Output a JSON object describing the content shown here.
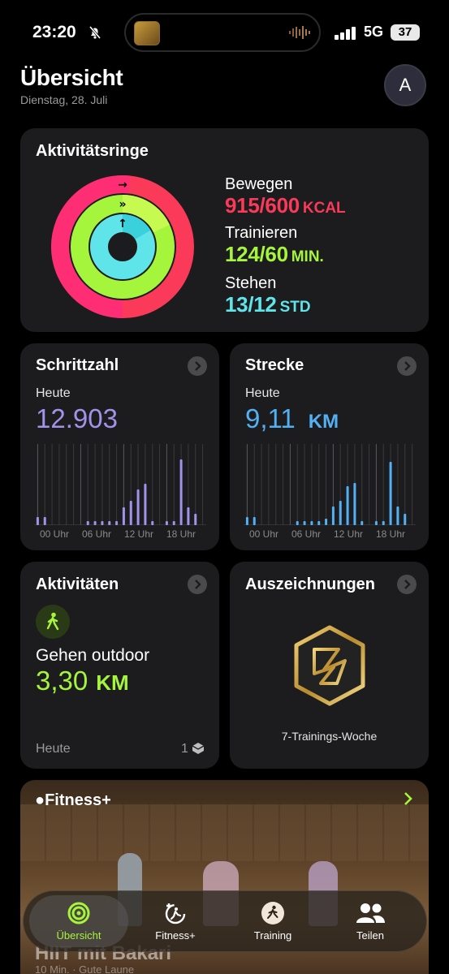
{
  "status_bar": {
    "time": "23:20",
    "network": "5G",
    "battery": "37"
  },
  "header": {
    "title": "Übersicht",
    "date": "Dienstag, 28. Juli",
    "avatar_initial": "A"
  },
  "rings": {
    "title": "Aktivitätsringe",
    "move": {
      "label": "Bewegen",
      "value": "915/600",
      "unit": "KCAL",
      "color": "#fa3a58",
      "progress": 1.525
    },
    "exercise": {
      "label": "Trainieren",
      "value": "124/60",
      "unit": "MIN.",
      "color": "#a6f53d",
      "progress": 2.067
    },
    "stand": {
      "label": "Stehen",
      "value": "13/12",
      "unit": "STD",
      "color": "#5fe4e9",
      "progress": 1.083
    }
  },
  "steps": {
    "title": "Schrittzahl",
    "sublabel": "Heute",
    "value": "12.903",
    "color": "#a392ea",
    "axis_labels": [
      "00 Uhr",
      "06 Uhr",
      "12 Uhr",
      "18 Uhr"
    ],
    "hourly": [
      0.1,
      0.1,
      0,
      0,
      0,
      0,
      0,
      0.05,
      0.05,
      0.05,
      0.05,
      0.05,
      0.22,
      0.3,
      0.44,
      0.51,
      0.05,
      0,
      0.05,
      0.05,
      0.81,
      0.22,
      0.14,
      0
    ]
  },
  "distance": {
    "title": "Strecke",
    "sublabel": "Heute",
    "value": "9,11",
    "unit": "KM",
    "color": "#52b0f5",
    "axis_labels": [
      "00 Uhr",
      "06 Uhr",
      "12 Uhr",
      "18 Uhr"
    ],
    "hourly": [
      0.1,
      0.1,
      0,
      0,
      0,
      0,
      0,
      0.05,
      0.05,
      0.05,
      0.05,
      0.08,
      0.23,
      0.3,
      0.48,
      0.52,
      0.05,
      0,
      0.05,
      0.05,
      0.78,
      0.23,
      0.14,
      0
    ]
  },
  "activities": {
    "title": "Aktivitäten",
    "name": "Gehen outdoor",
    "value": "3,30",
    "unit": "KM",
    "footer_label": "Heute",
    "count": "1",
    "color": "#a6f53d"
  },
  "awards": {
    "title": "Auszeichnungen",
    "badge_label": "7-Trainings-Woche"
  },
  "fitness_plus": {
    "brand": "Fitness+",
    "workout_title": "HIIT mit Bakari",
    "workout_meta": "10 Min. · Gute Laune"
  },
  "tab_bar": {
    "tabs": [
      {
        "label": "Übersicht",
        "active": true
      },
      {
        "label": "Fitness+",
        "active": false
      },
      {
        "label": "Training",
        "active": false
      },
      {
        "label": "Teilen",
        "active": false
      }
    ]
  }
}
